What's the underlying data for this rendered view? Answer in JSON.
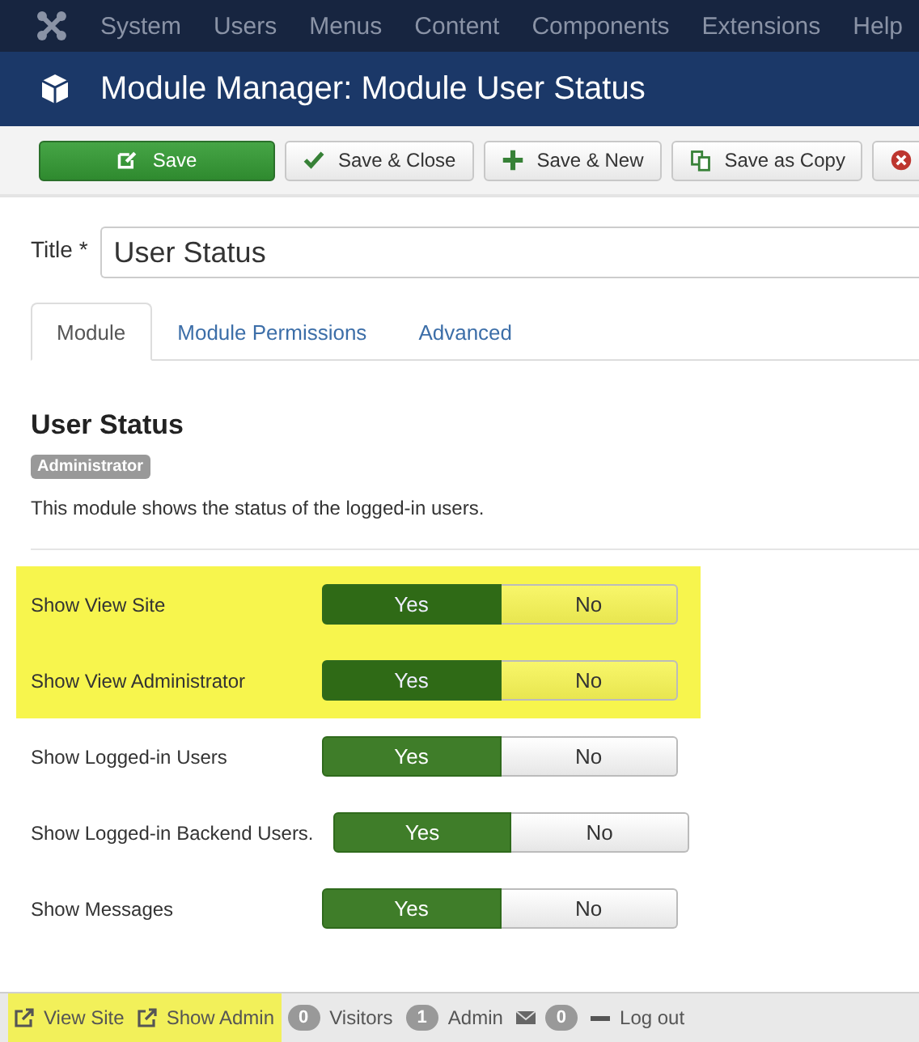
{
  "menu": {
    "items": [
      "System",
      "Users",
      "Menus",
      "Content",
      "Components",
      "Extensions",
      "Help"
    ]
  },
  "header": {
    "title": "Module Manager: Module User Status"
  },
  "toolbar": {
    "buttons": [
      {
        "kind": "save",
        "label": "Save"
      },
      {
        "kind": "check",
        "label": "Save & Close"
      },
      {
        "kind": "plus",
        "label": "Save & New"
      },
      {
        "kind": "copy",
        "label": "Save as Copy"
      },
      {
        "kind": "close"
      }
    ]
  },
  "title_field": {
    "label": "Title *",
    "value": "User Status"
  },
  "tabs": [
    {
      "label": "Module",
      "selected": true
    },
    {
      "label": "Module Permissions",
      "selected": false
    },
    {
      "label": "Advanced",
      "selected": false
    }
  ],
  "module": {
    "heading": "User Status",
    "badge": "Administrator",
    "description": "This module shows the status of the logged-in users."
  },
  "options": [
    {
      "label": "Show View Site",
      "choices": [
        {
          "label": "Yes",
          "selected": true
        },
        {
          "label": "No",
          "selected": false
        }
      ],
      "highlighted": true
    },
    {
      "label": "Show View Administrator",
      "choices": [
        {
          "label": "Yes",
          "selected": true
        },
        {
          "label": "No",
          "selected": false
        }
      ],
      "highlighted": true
    },
    {
      "label": "Show Logged-in Users",
      "choices": [
        {
          "label": "Yes",
          "selected": true
        },
        {
          "label": "No",
          "selected": false
        }
      ],
      "highlighted": false
    },
    {
      "label": "Show Logged-in Backend Users.",
      "choices": [
        {
          "label": "Yes",
          "selected": true
        },
        {
          "label": "No",
          "selected": false
        }
      ],
      "highlighted": false
    },
    {
      "label": "Show Messages",
      "choices": [
        {
          "label": "Yes",
          "selected": true
        },
        {
          "label": "No",
          "selected": false
        }
      ],
      "highlighted": false
    }
  ],
  "status_bar": {
    "items": [
      {
        "kind": "link",
        "label": "View Site",
        "highlighted": true
      },
      {
        "kind": "link",
        "label": "Show Admin",
        "highlighted": true
      },
      {
        "kind": "count",
        "count": "0",
        "label": "Visitors",
        "highlighted": false
      },
      {
        "kind": "count",
        "count": "1",
        "label": "Admin",
        "highlighted": false
      },
      {
        "kind": "mail",
        "count": "0",
        "highlighted": false
      },
      {
        "kind": "logout",
        "label": "Log out",
        "highlighted": false
      }
    ]
  }
}
